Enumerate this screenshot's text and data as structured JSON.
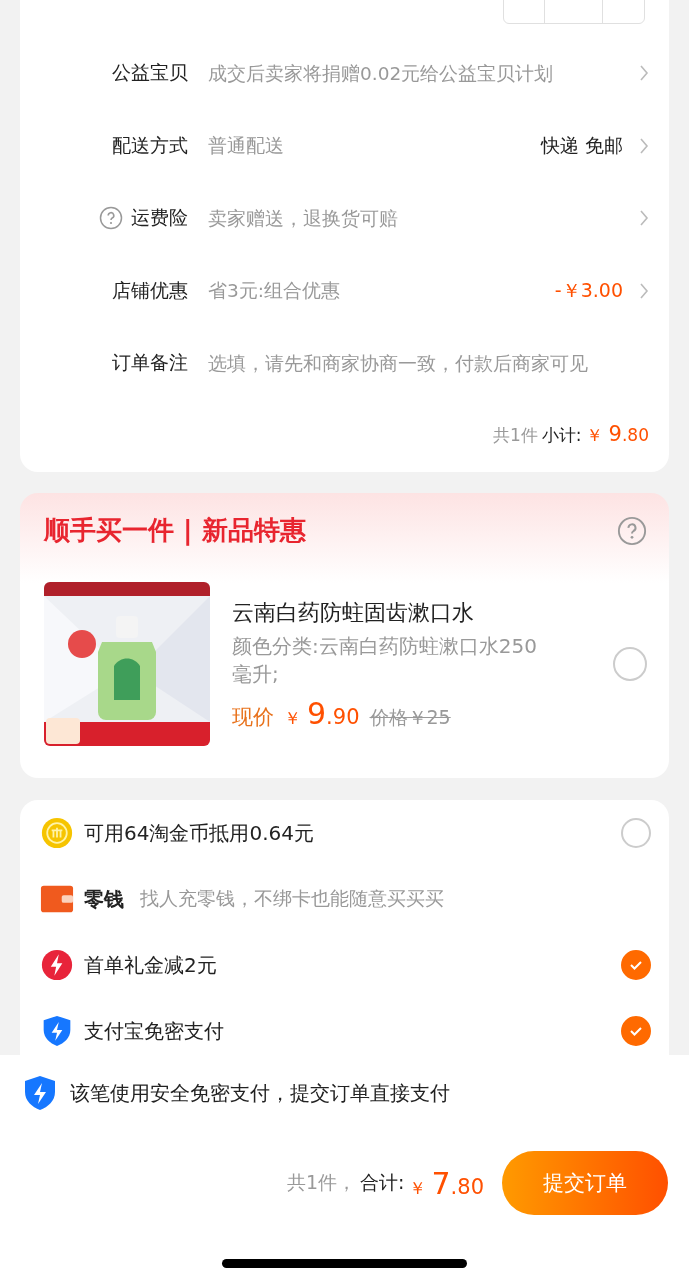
{
  "order_rows": [
    {
      "label": "公益宝贝",
      "value": "成交后卖家将捐赠0.02元给公益宝贝计划",
      "chevron": true
    },
    {
      "label": "配送方式",
      "value": "普通配送",
      "trailing": "快递 免邮",
      "color": "#222222",
      "chevron": true
    },
    {
      "label": "运费险",
      "help": true,
      "value": "卖家赠送，退换货可赔",
      "chevron": true
    },
    {
      "label": "店铺优惠",
      "value": "省3元:组合优惠",
      "trailing": "-￥3.00",
      "color": "#ff5000",
      "chevron": true
    },
    {
      "label": "订单备注",
      "value": "选填，请先和商家协商一致，付款后商家可见",
      "chevron": false
    }
  ],
  "subtotal": {
    "count": "共1件",
    "label": "小计:",
    "currency": "￥",
    "integer": "9",
    "decimal": ".80"
  },
  "addon": {
    "title": "顺手买一件 | 新品特惠",
    "product": {
      "name": "云南白药防蛀固齿漱口水",
      "spec": "颜色分类:云南白药防蛀漱口水250毫升;",
      "price_label": "现价",
      "currency": "￥",
      "integer": "9",
      "decimal": ".90",
      "original_price": "价格￥25",
      "selected": false
    }
  },
  "payment_options": [
    {
      "kind": "coin",
      "label": "可用64淘金币抵用0.64元",
      "selected": false
    },
    {
      "kind": "wallet",
      "label": "零钱",
      "note": "找人充零钱，不绑卡也能随意买买买"
    },
    {
      "kind": "bolt",
      "label": "首单礼金减2元",
      "selected": true
    },
    {
      "kind": "shield",
      "label": "支付宝免密支付",
      "selected": true
    }
  ],
  "footer": {
    "notice": "该笔使用安全免密支付，提交订单直接支付",
    "count": "共1件，",
    "total_label": "合计:",
    "currency": "￥",
    "integer": "7",
    "decimal": ".80",
    "submit": "提交订单"
  }
}
